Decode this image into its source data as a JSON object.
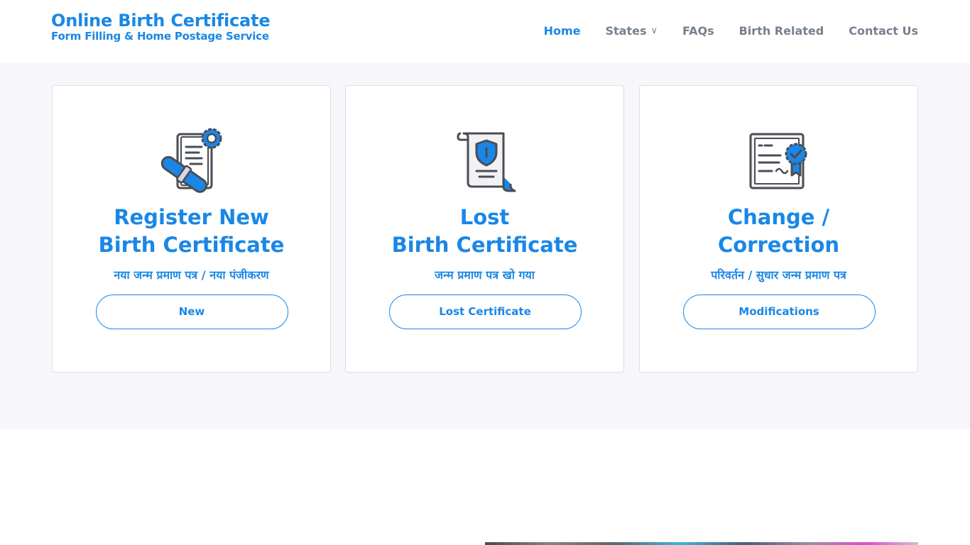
{
  "brand": {
    "title": "Online Birth Certificate",
    "subtitle": "Form Filling & Home Postage Service"
  },
  "nav": {
    "items": [
      {
        "label": "Home",
        "active": true
      },
      {
        "label": "States",
        "caret": "∨"
      },
      {
        "label": "FAQs"
      },
      {
        "label": "Birth Related"
      },
      {
        "label": "Contact Us"
      }
    ]
  },
  "cards": [
    {
      "icon": "certificate-scroll-gear-icon",
      "title_line1": "Register New",
      "title_line2": "Birth Certificate",
      "hindi": "नया जन्म प्रमाण पत्र / नया पंजीकरण",
      "button": "New"
    },
    {
      "icon": "shield-scroll-icon",
      "title_line1": "Lost",
      "title_line2": "Birth Certificate",
      "hindi": "जन्म प्रमाण पत्र खो गया",
      "button": "Lost Certificate"
    },
    {
      "icon": "certified-document-icon",
      "title_line1": "Change /",
      "title_line2": "Correction",
      "hindi": "परिवर्तन / सुधार जन्म प्रमाण पत्र",
      "button": "Modifications"
    }
  ],
  "colors": {
    "accent": "#1a87e6",
    "nav_text": "#77808d",
    "band_bg": "#f7f7fb",
    "icon_dark": "#4a4d55"
  }
}
